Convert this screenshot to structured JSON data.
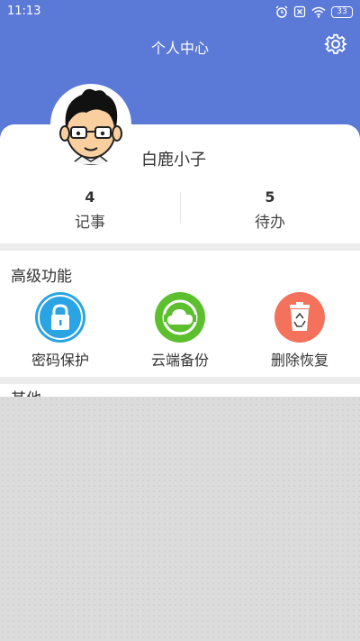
{
  "status_bar": {
    "time": "11:13",
    "battery": "33"
  },
  "header": {
    "title": "个人中心"
  },
  "profile": {
    "username": "白鹿小子"
  },
  "stats": [
    {
      "count": "4",
      "label": "记事"
    },
    {
      "count": "5",
      "label": "待办"
    }
  ],
  "advanced": {
    "title": "高级功能",
    "items": [
      {
        "label": "密码保护",
        "icon": "lock-icon",
        "color": "#2aa4e2"
      },
      {
        "label": "云端备份",
        "icon": "cloud-icon",
        "color": "#5cc02e"
      },
      {
        "label": "删除恢复",
        "icon": "recycle-bin-icon",
        "color": "#f4725c"
      }
    ]
  },
  "other": {
    "title": "其他"
  }
}
